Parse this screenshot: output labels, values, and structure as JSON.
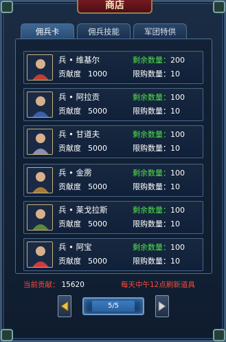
{
  "shop": {
    "title": "商店",
    "tabs": [
      {
        "label": "佣兵卡",
        "active": true
      },
      {
        "label": "佣兵技能",
        "active": false
      },
      {
        "label": "军团特供",
        "active": false
      }
    ],
    "items": [
      {
        "name": "兵 • 维基尔",
        "contribution_label": "贡献度",
        "contribution": "1000",
        "remaining": "剩余数量：200",
        "limit": "限购数量：10",
        "portrait_color": "#c04030"
      },
      {
        "name": "兵 • 阿拉贡",
        "contribution_label": "贡献度",
        "contribution": "5000",
        "remaining": "剩余数量：100",
        "limit": "限购数量：10",
        "portrait_color": "#3a5fa8"
      },
      {
        "name": "兵 • 甘道夫",
        "contribution_label": "贡献度",
        "contribution": "5000",
        "remaining": "剩余数量：100",
        "limit": "限购数量：10",
        "portrait_color": "#8a90b8"
      },
      {
        "name": "兵 • 金雳",
        "contribution_label": "贡献度",
        "contribution": "5000",
        "remaining": "剩余数量：100",
        "limit": "限购数量：10",
        "portrait_color": "#a87a3a"
      },
      {
        "name": "兵 • 莱戈拉斯",
        "contribution_label": "贡献度",
        "contribution": "5000",
        "remaining": "剩余数量：100",
        "limit": "限购数量：10",
        "portrait_color": "#5a8a3a"
      },
      {
        "name": "兵 • 阿宝",
        "contribution_label": "贡献度",
        "contribution": "5000",
        "remaining": "剩余数量：100",
        "limit": "限购数量：10",
        "portrait_color": "#d03a3a"
      }
    ],
    "current_label": "当前贡献：",
    "current_value": "15620",
    "refresh_note": "每天中午12点刷新道具",
    "page_indicator": "5/5"
  }
}
